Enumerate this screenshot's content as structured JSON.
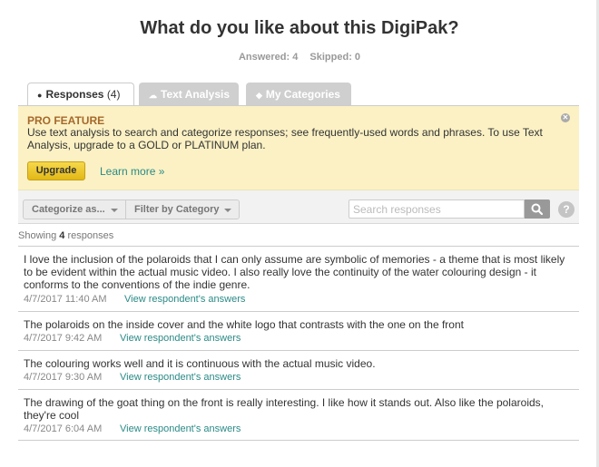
{
  "page": {
    "title": "What do you like about this DigiPak?",
    "answered_label": "Answered: 4",
    "skipped_label": "Skipped: 0"
  },
  "tabs": [
    {
      "label": "Responses",
      "count": "(4)",
      "icon": "speech-bubble-icon",
      "active": true
    },
    {
      "label": "Text Analysis",
      "icon": "cloud-icon",
      "active": false
    },
    {
      "label": "My Categories",
      "icon": "tag-icon",
      "active": false
    }
  ],
  "pro_feature": {
    "title": "PRO FEATURE",
    "text": "Use text analysis to search and categorize responses; see frequently-used words and phrases. To use Text Analysis, upgrade to a GOLD or PLATINUM plan.",
    "upgrade_label": "Upgrade",
    "learn_more_label": "Learn more »",
    "close_icon": "close-icon"
  },
  "toolbar": {
    "categorize_label": "Categorize as...",
    "filter_label": "Filter by Category",
    "search_placeholder": "Search responses",
    "help_label": "?"
  },
  "showing": {
    "prefix": "Showing",
    "count": "4",
    "suffix": "responses"
  },
  "responses": [
    {
      "text": "I love the inclusion of the polaroids that I can only assume are symbolic of memories - a theme that is most likely to be evident within the actual music video. I also really love the continuity of the water colouring design - it conforms to the conventions of the indie genre.",
      "timestamp": "4/7/2017 11:40 AM",
      "link": "View respondent's answers"
    },
    {
      "text": "The polaroids on the inside cover and the white logo that contrasts with the one on the front",
      "timestamp": "4/7/2017 9:42 AM",
      "link": "View respondent's answers"
    },
    {
      "text": "The colouring works well and it is continuous with the actual music video.",
      "timestamp": "4/7/2017 9:30 AM",
      "link": "View respondent's answers"
    },
    {
      "text": "The drawing of the goat thing on the front is really interesting. I like how it stands out. Also like the polaroids, they're cool",
      "timestamp": "4/7/2017 6:04 AM",
      "link": "View respondent's answers"
    }
  ],
  "colors": {
    "accent_link": "#2a8a86",
    "pro_background": "#fbf1c4",
    "upgrade_button": "#f6d84a"
  }
}
